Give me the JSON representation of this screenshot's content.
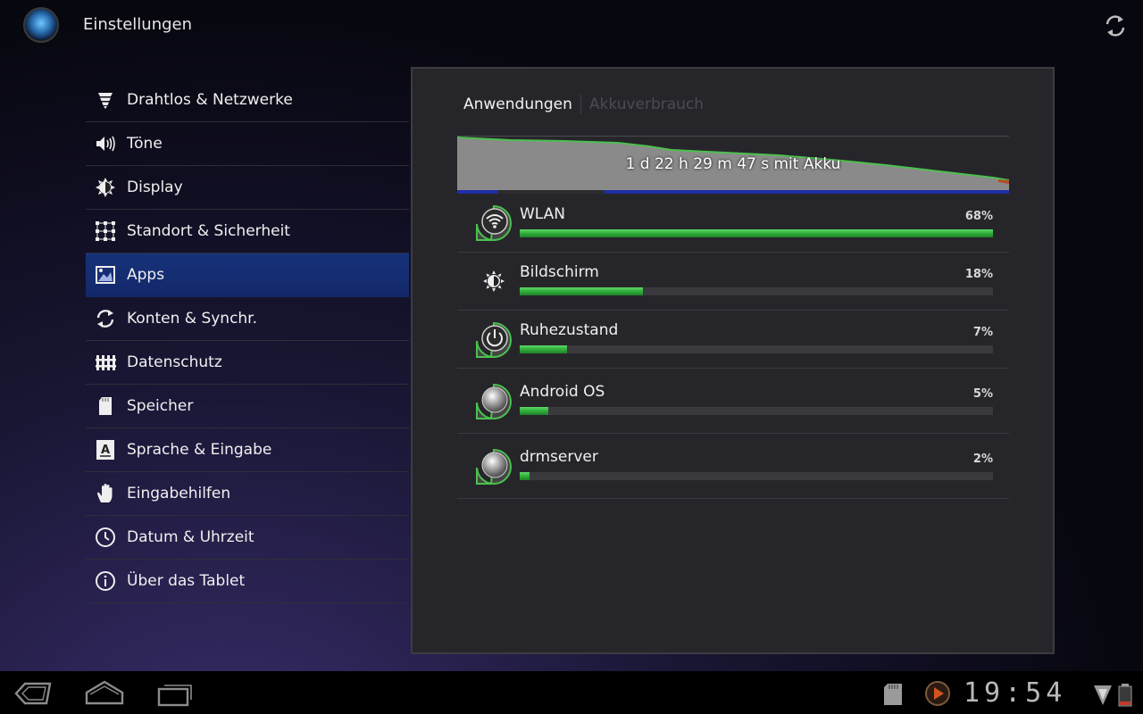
{
  "app": {
    "title": "Einstellungen",
    "icon": "settings-app-icon"
  },
  "actionbar": {
    "refresh_icon": "refresh-icon"
  },
  "nav": {
    "items": [
      {
        "label": "Drahtlos & Netzwerke",
        "icon": "wireless-icon",
        "active": false
      },
      {
        "label": "Töne",
        "icon": "sound-icon",
        "active": false
      },
      {
        "label": "Display",
        "icon": "display-icon",
        "active": false
      },
      {
        "label": "Standort & Sicherheit",
        "icon": "location-grid-icon",
        "active": false
      },
      {
        "label": "Apps",
        "icon": "apps-icon",
        "active": true
      },
      {
        "label": "Konten & Synchr.",
        "icon": "sync-icon",
        "active": false
      },
      {
        "label": "Datenschutz",
        "icon": "privacy-icon",
        "active": false
      },
      {
        "label": "Speicher",
        "icon": "storage-icon",
        "active": false
      },
      {
        "label": "Sprache & Eingabe",
        "icon": "language-icon",
        "active": false
      },
      {
        "label": "Eingabehilfen",
        "icon": "accessibility-icon",
        "active": false
      },
      {
        "label": "Datum & Uhrzeit",
        "icon": "clock-icon",
        "active": false
      },
      {
        "label": "Über das Tablet",
        "icon": "info-icon",
        "active": false
      }
    ]
  },
  "panel": {
    "tabs": [
      {
        "label": "Anwendungen",
        "active": true
      },
      {
        "label": "Akkuverbrauch",
        "active": false
      }
    ],
    "battery_graph": {
      "label": "1 d 22 h 29 m 47 s mit Akku",
      "colors": {
        "fill": "#8a8a8a",
        "line": "#4cc14f",
        "baseline": "#1d2fa8"
      }
    },
    "usage": [
      {
        "name": "WLAN",
        "percent_label": "68%",
        "fraction": 1.0,
        "icon": "wifi-drop-icon"
      },
      {
        "name": "Bildschirm",
        "percent_label": "18%",
        "fraction": 0.26,
        "icon": "brightness-icon"
      },
      {
        "name": "Ruhezustand",
        "percent_label": "7%",
        "fraction": 0.1,
        "icon": "power-drop-icon"
      },
      {
        "name": "Android OS",
        "percent_label": "5%",
        "fraction": 0.06,
        "icon": "system-drop-icon"
      },
      {
        "name": "drmserver",
        "percent_label": "2%",
        "fraction": 0.02,
        "icon": "system-drop-icon"
      }
    ]
  },
  "system_bar": {
    "back_icon": "back-icon",
    "home_icon": "home-icon",
    "recents_icon": "recent-apps-icon",
    "sd_icon": "sd-card-icon",
    "media_icon": "media-play-icon",
    "clock": "19:54",
    "signal_icon": "signal-icon",
    "battery_icon": "battery-icon"
  },
  "colors": {
    "accent": "#17327a",
    "bar_green": "#33b23c"
  }
}
